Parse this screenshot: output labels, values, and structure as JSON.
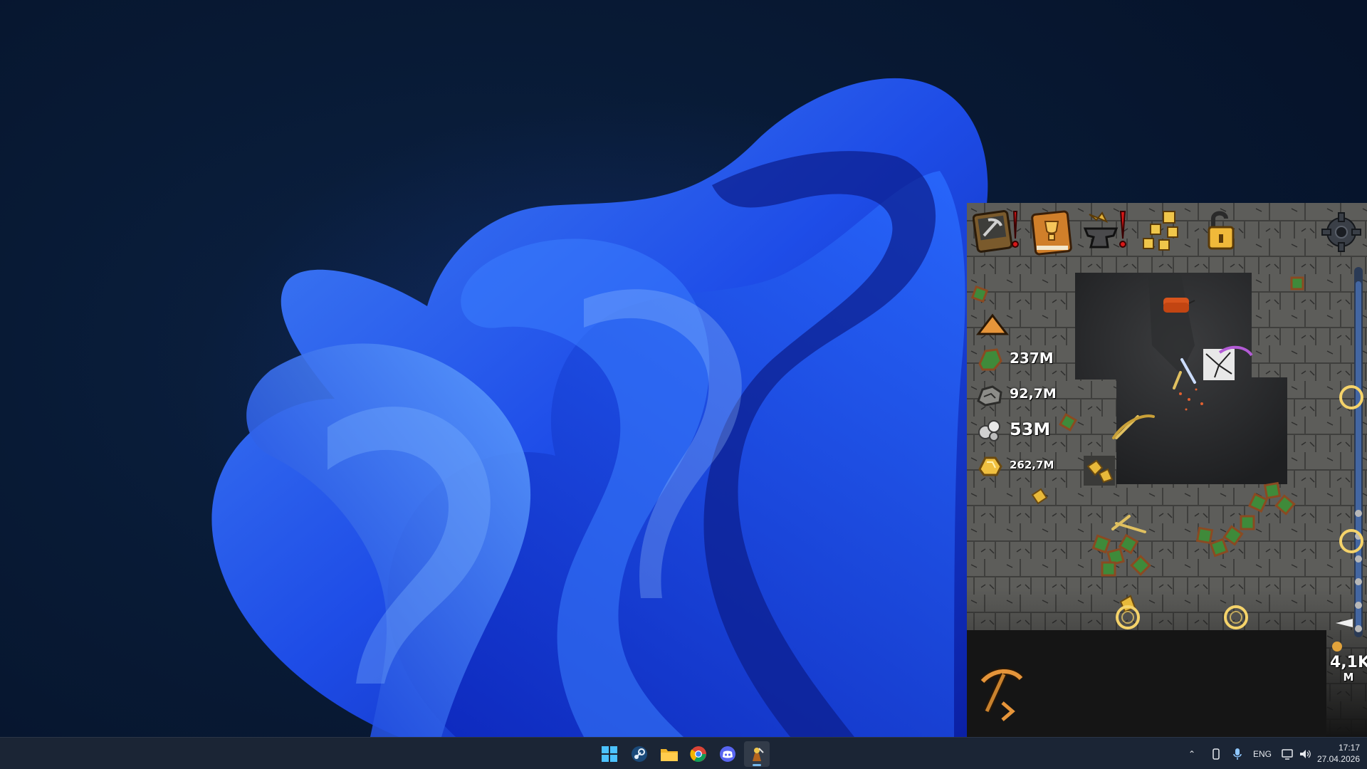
{
  "desktop": {
    "wallpaper": "windows-11-bloom-dark",
    "colors": {
      "background": "#081a35",
      "bloom": "#1f4ff0"
    }
  },
  "game": {
    "toolbar": [
      {
        "name": "pickaxe-collection-button",
        "icon": "pickaxe-card-icon",
        "alert": true
      },
      {
        "name": "trophy-book-button",
        "icon": "trophy-book-icon",
        "alert": false
      },
      {
        "name": "forge-anvil-button",
        "icon": "anvil-icon",
        "alert": true
      },
      {
        "name": "skill-tree-button",
        "icon": "skill-tree-icon",
        "alert": false
      },
      {
        "name": "unlock-button",
        "icon": "padlock-open-icon",
        "alert": false
      },
      {
        "name": "settings-button",
        "icon": "gear-icon",
        "alert": false
      }
    ],
    "resources": [
      {
        "icon": "green-ore-icon",
        "value": "237M"
      },
      {
        "icon": "stone-icon",
        "value": "92,7M"
      },
      {
        "icon": "silver-ore-icon",
        "value": "53M"
      },
      {
        "icon": "gold-ore-icon",
        "value": "262,7M"
      }
    ],
    "depth": {
      "value": "4,1K",
      "unit": "M"
    },
    "colors": {
      "gold": "#e2a33b",
      "ring": "#f5d36a",
      "rock": "#5a5a58"
    }
  },
  "taskbar": {
    "apps": [
      {
        "name": "start-button",
        "icon": "windows-logo-icon"
      },
      {
        "name": "steam-button",
        "icon": "steam-icon"
      },
      {
        "name": "file-explorer-button",
        "icon": "folder-icon"
      },
      {
        "name": "chrome-button",
        "icon": "chrome-icon"
      },
      {
        "name": "discord-button",
        "icon": "discord-icon"
      },
      {
        "name": "game-app-button",
        "icon": "game-miner-icon",
        "active": true
      }
    ],
    "tray": {
      "language": "ENG",
      "time": "17:17",
      "date": "27.04.2026"
    }
  }
}
